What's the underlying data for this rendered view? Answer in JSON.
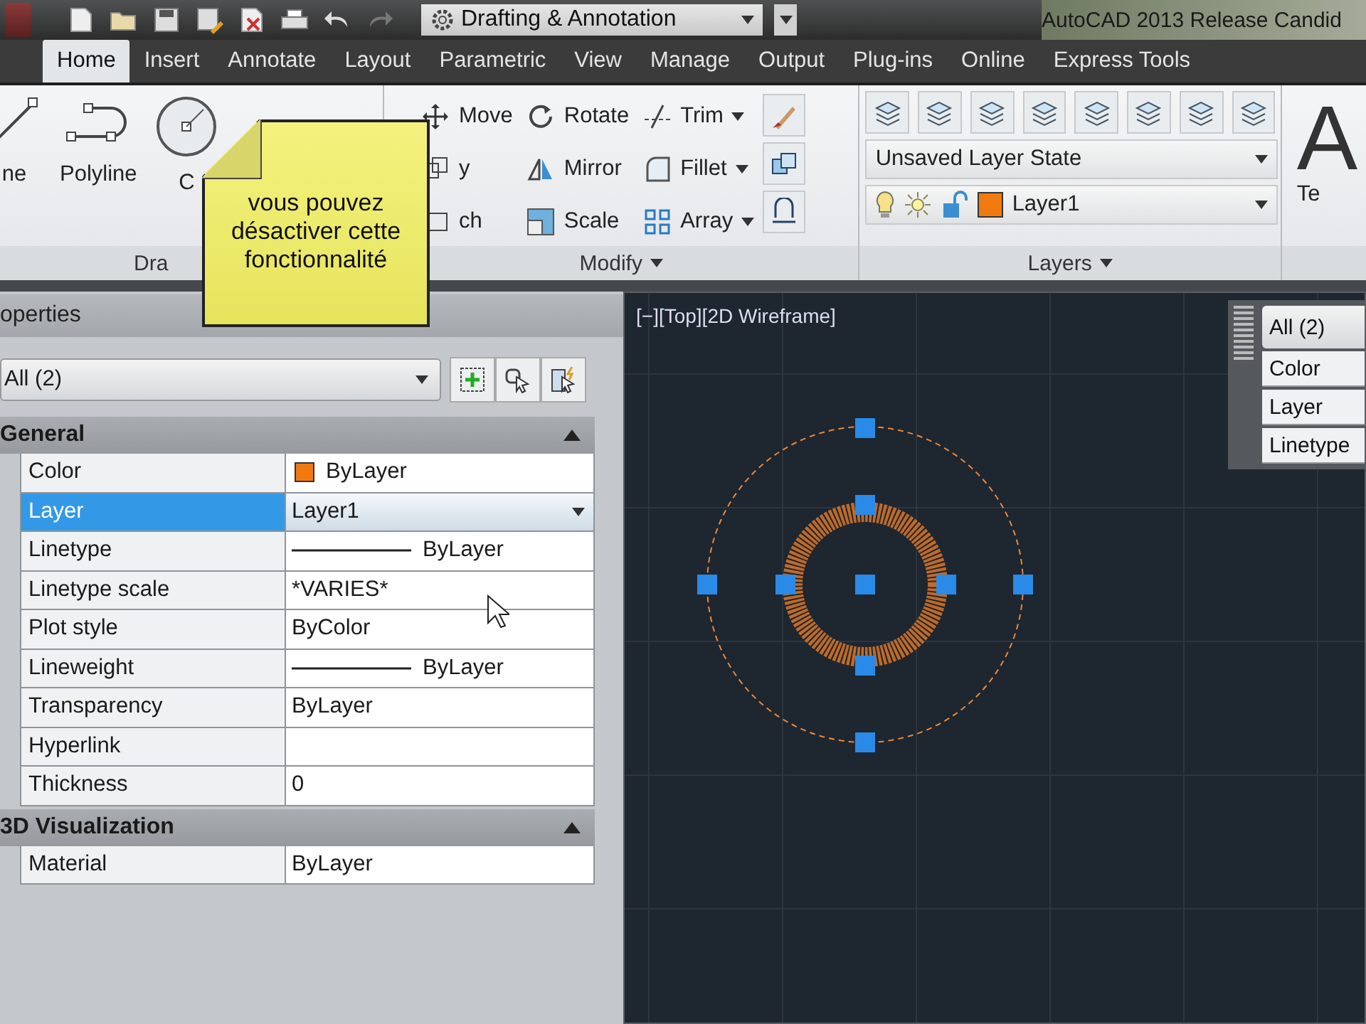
{
  "window": {
    "title": "AutoCAD 2013 Release Candid"
  },
  "quick_access_toolbar": {
    "workspace": "Drafting & Annotation"
  },
  "tabs": [
    {
      "label": "Home",
      "selected": true
    },
    {
      "label": "Insert",
      "selected": false
    },
    {
      "label": "Annotate",
      "selected": false
    },
    {
      "label": "Layout",
      "selected": false
    },
    {
      "label": "Parametric",
      "selected": false
    },
    {
      "label": "View",
      "selected": false
    },
    {
      "label": "Manage",
      "selected": false
    },
    {
      "label": "Output",
      "selected": false
    },
    {
      "label": "Plug-ins",
      "selected": false
    },
    {
      "label": "Online",
      "selected": false
    },
    {
      "label": "Express Tools",
      "selected": false
    }
  ],
  "ribbon": {
    "draw_panel": {
      "title": "Dra",
      "tools": [
        "ne",
        "Polyline",
        "C"
      ]
    },
    "modify_panel": {
      "title": "Modify",
      "tools": [
        {
          "label": "Move",
          "dropdown": false
        },
        {
          "label": "Rotate",
          "dropdown": false
        },
        {
          "label": "Trim",
          "dropdown": true
        },
        {
          "label": "y",
          "dropdown": false
        },
        {
          "label": "Mirror",
          "dropdown": false
        },
        {
          "label": "Fillet",
          "dropdown": true
        },
        {
          "label": "ch",
          "dropdown": false
        },
        {
          "label": "Scale",
          "dropdown": false
        },
        {
          "label": "Array",
          "dropdown": true
        }
      ]
    },
    "layers_panel": {
      "title": "Layers",
      "layer_state": "Unsaved Layer State",
      "current_layer": {
        "name": "Layer1",
        "color": "#f07a10"
      }
    },
    "annotation_panel": {
      "glyph": "A",
      "label": "Te"
    }
  },
  "properties_palette": {
    "title": "operties",
    "selection": "All (2)",
    "sections": [
      {
        "title": "General",
        "expanded": true,
        "rows": [
          {
            "label": "Color",
            "value": "ByLayer",
            "kind": "color",
            "color": "#f07a10",
            "selected": false
          },
          {
            "label": "Layer",
            "value": "Layer1",
            "kind": "dropdown",
            "selected": true
          },
          {
            "label": "Linetype",
            "value": "ByLayer",
            "kind": "line",
            "selected": false
          },
          {
            "label": "Linetype scale",
            "value": "*VARIES*",
            "kind": "text",
            "selected": false
          },
          {
            "label": "Plot style",
            "value": "ByColor",
            "kind": "text",
            "selected": false
          },
          {
            "label": "Lineweight",
            "value": "ByLayer",
            "kind": "line",
            "selected": false
          },
          {
            "label": "Transparency",
            "value": "ByLayer",
            "kind": "text",
            "selected": false
          },
          {
            "label": "Hyperlink",
            "kind": "text",
            "selected": false
          },
          {
            "label": "Thickness",
            "value": "0",
            "kind": "text",
            "selected": false
          }
        ]
      },
      {
        "title": "3D Visualization",
        "expanded": true,
        "rows": [
          {
            "label": "Material",
            "value": "ByLayer",
            "kind": "text",
            "selected": false
          }
        ]
      }
    ]
  },
  "viewport": {
    "label": "[−][Top][2D Wireframe]"
  },
  "quick_properties": {
    "selection": "All (2)",
    "rows": [
      "Color",
      "Layer",
      "Linetype"
    ]
  },
  "tooltip": {
    "text": "vous pouvez désactiver cette fonctionnalité"
  }
}
